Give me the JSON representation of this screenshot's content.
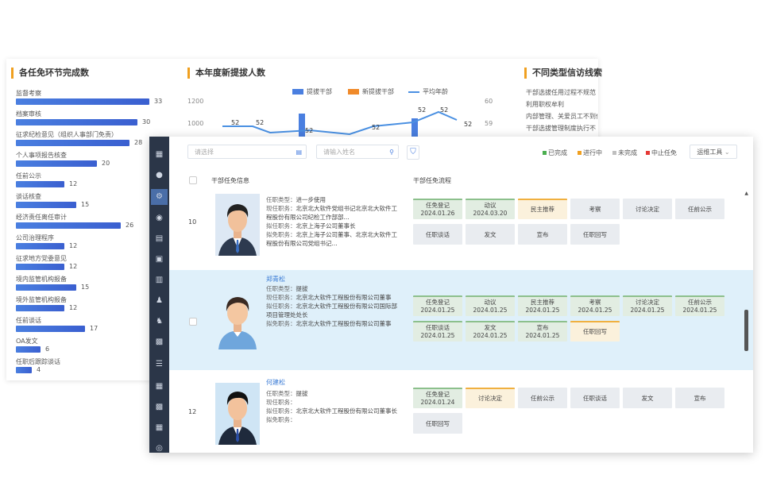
{
  "left_panel": {
    "title": "各任免环节完成数",
    "bars": [
      {
        "label": "监督考察",
        "value": 33
      },
      {
        "label": "档案审核",
        "value": 30
      },
      {
        "label": "征求纪检意见（组织人事部门免责）",
        "value": 28
      },
      {
        "label": "个人事项报告核查",
        "value": 20
      },
      {
        "label": "任前公示",
        "value": 12
      },
      {
        "label": "谈话核查",
        "value": 15
      },
      {
        "label": "经济责任离任审计",
        "value": 26
      },
      {
        "label": "公司治理程序",
        "value": 12
      },
      {
        "label": "征求地方党委意见",
        "value": 12
      },
      {
        "label": "境内监管机构报备",
        "value": 15
      },
      {
        "label": "境外监管机构报备",
        "value": 12
      },
      {
        "label": "任前谈话",
        "value": 17
      },
      {
        "label": "OA发文",
        "value": 6
      },
      {
        "label": "任职后跟踪谈话",
        "value": 4
      }
    ]
  },
  "mid_panel": {
    "title": "本年度新提拔人数",
    "legend": [
      "提拔干部",
      "新提拔干部",
      "平均年龄"
    ],
    "y_ticks": [
      "1200",
      "1000"
    ],
    "labels": [
      "52",
      "52",
      "52",
      "52",
      "52",
      "52",
      "52"
    ]
  },
  "right_panel": {
    "title": "不同类型信访线索",
    "y_ticks": [
      "60",
      "59"
    ],
    "lines": [
      "干部选拔任用过程不规范",
      "利用职权牟利",
      "内部管理、关爱员工不到位",
      "干部选拔管理制度执行不"
    ]
  },
  "toolbar": {
    "search1_placeholder": "请选择",
    "search2_placeholder": "请输入姓名",
    "status_legend": [
      {
        "label": "已完成",
        "color": "#4caf50"
      },
      {
        "label": "进行中",
        "color": "#f0a020"
      },
      {
        "label": "未完成",
        "color": "#bfbfbf"
      },
      {
        "label": "中止任免",
        "color": "#e53935"
      }
    ],
    "tools_label": "运维工具"
  },
  "table": {
    "headers": [
      "干部任免信息",
      "干部任免流程"
    ],
    "rows": [
      {
        "num": "10",
        "name": "",
        "fields": [
          {
            "k": "任职类型：",
            "v": "进一步使用"
          },
          {
            "k": "现任职务：",
            "v": "北京北大软件党组书记北京北大软件工程股份有限公司纪检工作部部..."
          },
          {
            "k": "拟任职务：",
            "v": "北京上海子公司董事长"
          },
          {
            "k": "拟免职务：",
            "v": "北京上海子公司董事、北京北大软件工程股份有限公司党组书记..."
          }
        ],
        "steps": [
          {
            "label": "任免登记",
            "date": "2024.01.26",
            "state": "done"
          },
          {
            "label": "动议",
            "date": "2024.03.20",
            "state": "done"
          },
          {
            "label": "民主推荐",
            "date": "",
            "state": "doing"
          },
          {
            "label": "考察",
            "date": "",
            "state": "todo"
          },
          {
            "label": "讨论决定",
            "date": "",
            "state": "todo"
          },
          {
            "label": "任前公示",
            "date": "",
            "state": "todo"
          },
          {
            "label": "任职谈话",
            "date": "",
            "state": "todo"
          },
          {
            "label": "发文",
            "date": "",
            "state": "todo"
          },
          {
            "label": "宣布",
            "date": "",
            "state": "todo"
          },
          {
            "label": "任职回写",
            "date": "",
            "state": "todo"
          }
        ]
      },
      {
        "num": "",
        "name": "郑青松",
        "fields": [
          {
            "k": "任职类型：",
            "v": "提拔"
          },
          {
            "k": "现任职务：",
            "v": "北京北大软件工程股份有限公司董事"
          },
          {
            "k": "拟任职务：",
            "v": "北京北大软件工程股份有限公司国际部项目管理处处长"
          },
          {
            "k": "拟免职务：",
            "v": "北京北大软件工程股份有限公司董事"
          }
        ],
        "steps": [
          {
            "label": "任免登记",
            "date": "2024.01.25",
            "state": "done"
          },
          {
            "label": "动议",
            "date": "2024.01.25",
            "state": "done"
          },
          {
            "label": "民主推荐",
            "date": "2024.01.25",
            "state": "done"
          },
          {
            "label": "考察",
            "date": "2024.01.25",
            "state": "done"
          },
          {
            "label": "讨论决定",
            "date": "2024.01.25",
            "state": "done"
          },
          {
            "label": "任前公示",
            "date": "2024.01.25",
            "state": "done"
          },
          {
            "label": "任职谈话",
            "date": "2024.01.25",
            "state": "done"
          },
          {
            "label": "发文",
            "date": "2024.01.25",
            "state": "done"
          },
          {
            "label": "宣布",
            "date": "2024.01.25",
            "state": "done"
          },
          {
            "label": "任职回写",
            "date": "",
            "state": "doing"
          }
        ]
      },
      {
        "num": "12",
        "name": "何建松",
        "fields": [
          {
            "k": "任职类型：",
            "v": "提拔"
          },
          {
            "k": "现任职务：",
            "v": ""
          },
          {
            "k": "拟任职务：",
            "v": "北京北大软件工程股份有限公司董事长"
          },
          {
            "k": "拟免职务：",
            "v": ""
          }
        ],
        "steps": [
          {
            "label": "任免登记",
            "date": "2024.01.24",
            "state": "done"
          },
          {
            "label": "讨论决定",
            "date": "",
            "state": "doing"
          },
          {
            "label": "任前公示",
            "date": "",
            "state": "todo"
          },
          {
            "label": "任职谈话",
            "date": "",
            "state": "todo"
          },
          {
            "label": "发文",
            "date": "",
            "state": "todo"
          },
          {
            "label": "宣布",
            "date": "",
            "state": "todo"
          },
          {
            "label": "任职回写",
            "date": "",
            "state": "todo"
          }
        ]
      }
    ]
  }
}
